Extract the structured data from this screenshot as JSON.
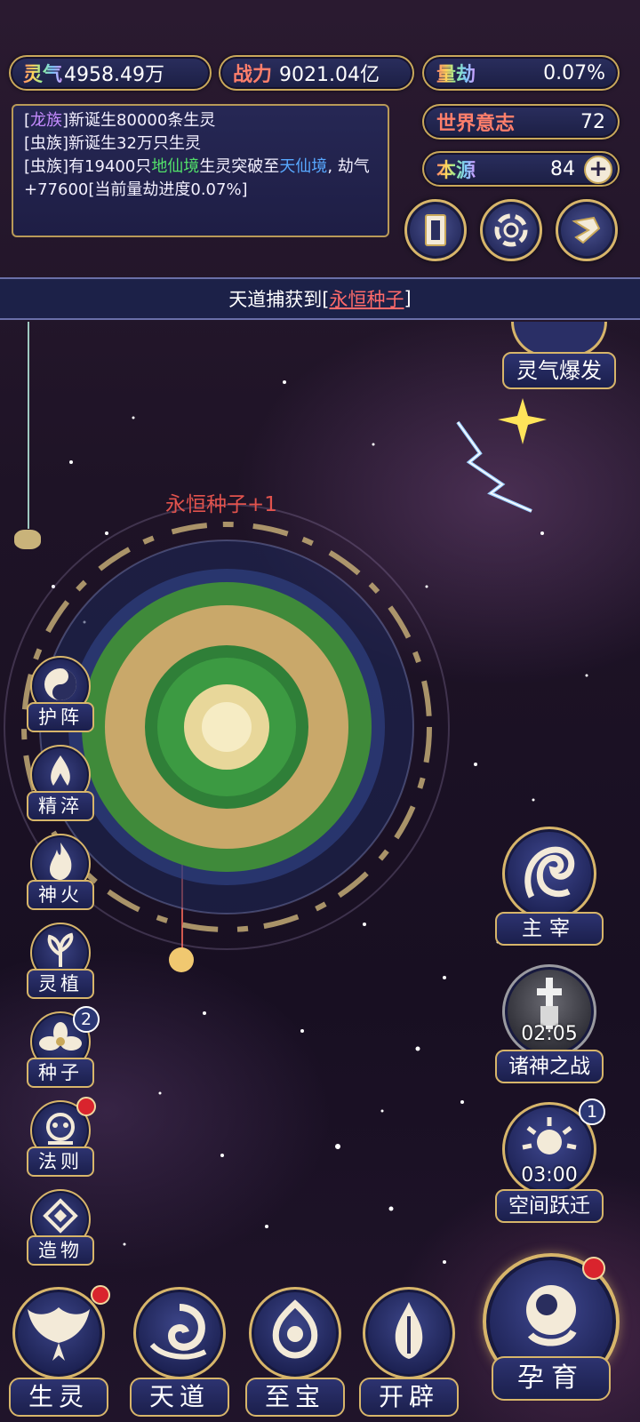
{
  "stats": {
    "lingqi": {
      "label": "灵气",
      "value": "4958.49万"
    },
    "zhanli": {
      "label": "战力",
      "value": "9021.04亿"
    },
    "liangjie": {
      "label": "量劫",
      "value": "0.07%"
    },
    "shijie": {
      "label": "世界意志",
      "value": "72"
    },
    "benyuan": {
      "label": "本源",
      "value": "84"
    }
  },
  "log": {
    "line1_prefix": "[",
    "line1_race": "龙族",
    "line1_rest": "]新诞生80000条生灵",
    "line2": "[虫族]新诞生32万只生灵",
    "line3_a": "[虫族]有19400只",
    "line3_realm1": "地仙境",
    "line3_b": "生灵突破至",
    "line3_realm2": "天仙境",
    "line3_c": ", 劫气+77600[当前量劫进度0.07%]"
  },
  "banner": {
    "prefix": "天道捕获到[",
    "item": "永恒种子",
    "suffix": "]"
  },
  "float_text": "永恒种子+1",
  "burst_button": {
    "label": "灵气爆发"
  },
  "left_buttons": [
    {
      "label": "护阵",
      "icon": "yin-yang-icon"
    },
    {
      "label": "精淬",
      "icon": "lotus-flame-icon"
    },
    {
      "label": "神火",
      "icon": "flame-icon"
    },
    {
      "label": "灵植",
      "icon": "plant-icon"
    },
    {
      "label": "种子",
      "icon": "seed-icon",
      "badge": "2"
    },
    {
      "label": "法则",
      "icon": "rule-icon"
    },
    {
      "label": "造物",
      "icon": "creation-icon"
    }
  ],
  "right_buttons": {
    "zhuzai": {
      "label": "主宰",
      "icon": "dragon-icon"
    },
    "zhushen": {
      "label": "诸神之战",
      "timer": "02:05",
      "icon": "sword-icon"
    },
    "kongjian": {
      "label": "空间跃迁",
      "timer": "03:00",
      "badge": "1",
      "icon": "portal-icon"
    }
  },
  "bottom_nav": [
    {
      "label": "生灵",
      "icon": "phoenix-icon"
    },
    {
      "label": "天道",
      "icon": "swirl-icon"
    },
    {
      "label": "至宝",
      "icon": "treasure-icon"
    },
    {
      "label": "开辟",
      "icon": "axe-icon"
    }
  ],
  "yunyu": {
    "label": "孕育",
    "icon": "embryo-icon"
  },
  "colors": {
    "gold": "#d7b56a",
    "panel": "#1c2148",
    "accent_red": "#e2534d"
  }
}
